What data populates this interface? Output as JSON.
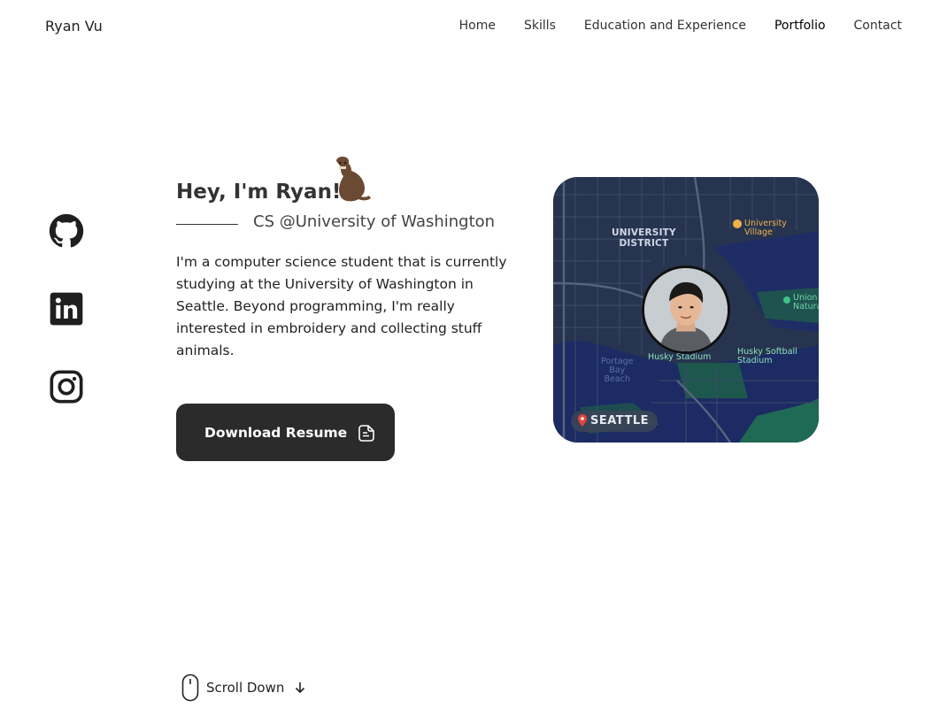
{
  "header": {
    "brand": "Ryan Vu",
    "nav": [
      {
        "label": "Home",
        "active": false
      },
      {
        "label": "Skills",
        "active": false
      },
      {
        "label": "Education and Experience",
        "active": false
      },
      {
        "label": "Portfolio",
        "active": true
      },
      {
        "label": "Contact",
        "active": false
      }
    ]
  },
  "social": [
    {
      "name": "github-icon"
    },
    {
      "name": "linkedin-icon"
    },
    {
      "name": "instagram-icon"
    }
  ],
  "hero": {
    "greeting": "Hey, I'm Ryan!",
    "subtitle": "CS @University of Washington",
    "bio": "I'm a computer science student that is currently studying at the University of Washington in Seattle. Beyond programming, I'm really interested in embroidery and collecting stuff animals.",
    "resume_button": "Download Resume"
  },
  "map": {
    "district": "UNIVERSITY\nDISTRICT",
    "village": "University\nVillage",
    "natural": "Union\nNatura",
    "stadium": "Husky Stadium",
    "softball": "Husky Softball\nStadium",
    "portage": "Portage\nBay\nBeach",
    "city": "SEATTLE"
  },
  "scroll": {
    "label": "Scroll Down"
  },
  "colors": {
    "button_bg": "#2b2b2b",
    "map_bg": "#223049",
    "icon": "#1f1f1f"
  }
}
